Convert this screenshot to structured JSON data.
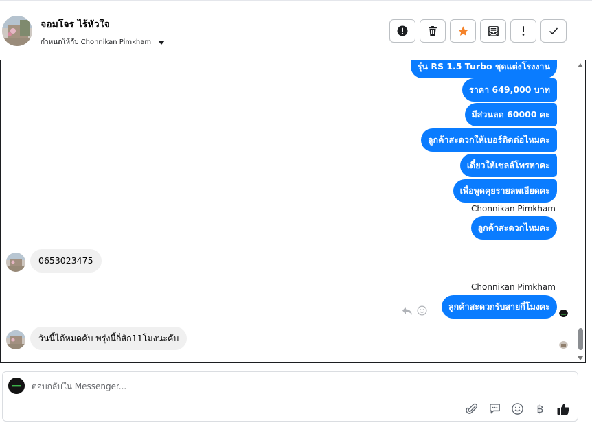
{
  "header": {
    "contact_name": "จอมโจร ไร้หัวใจ",
    "assigned_to": "กำหนดให้กับ Chonnikan Pimkham"
  },
  "actions": [
    {
      "name": "report-spam-button",
      "icon": "alert-circle-icon"
    },
    {
      "name": "delete-button",
      "icon": "trash-icon"
    },
    {
      "name": "star-button",
      "icon": "star-icon",
      "color": "#f5832a"
    },
    {
      "name": "move-to-done-button",
      "icon": "mail-archive-icon"
    },
    {
      "name": "mark-important-button",
      "icon": "exclamation-icon"
    },
    {
      "name": "mark-done-button",
      "icon": "check-icon"
    }
  ],
  "thread": {
    "outgoing_1": [
      "รุ่น RS 1.5 Turbo ชุดแต่งโรงงาน",
      "ราคา 649,000 บาท",
      "มีส่วนลด 60000 คะ",
      "ลูกค้าสะดวกให้เบอร์ติดต่อไหมคะ",
      "เดี๋ยวให้เซลล์โทรหาคะ",
      "เพื่อพูดคุยรายลพเอียดคะ"
    ],
    "sender_label_1": "Chonnikan Pimkham",
    "outgoing_2": "ลูกค้าสะดวกไหมคะ",
    "incoming_1": "0653023475",
    "sender_label_2": "Chonnikan Pimkham",
    "outgoing_3": "ลูกค้าสะดวกรับสายกี่โมงคะ",
    "incoming_2": "วันนี้ได้หมดคับ พรุ่งนี้ก็สัก11โมงนะคับ"
  },
  "composer": {
    "placeholder": "ตอบกลับใน Messenger...",
    "currency_symbol": "฿"
  },
  "colors": {
    "accent": "#0a7cff",
    "star": "#f5832a"
  }
}
